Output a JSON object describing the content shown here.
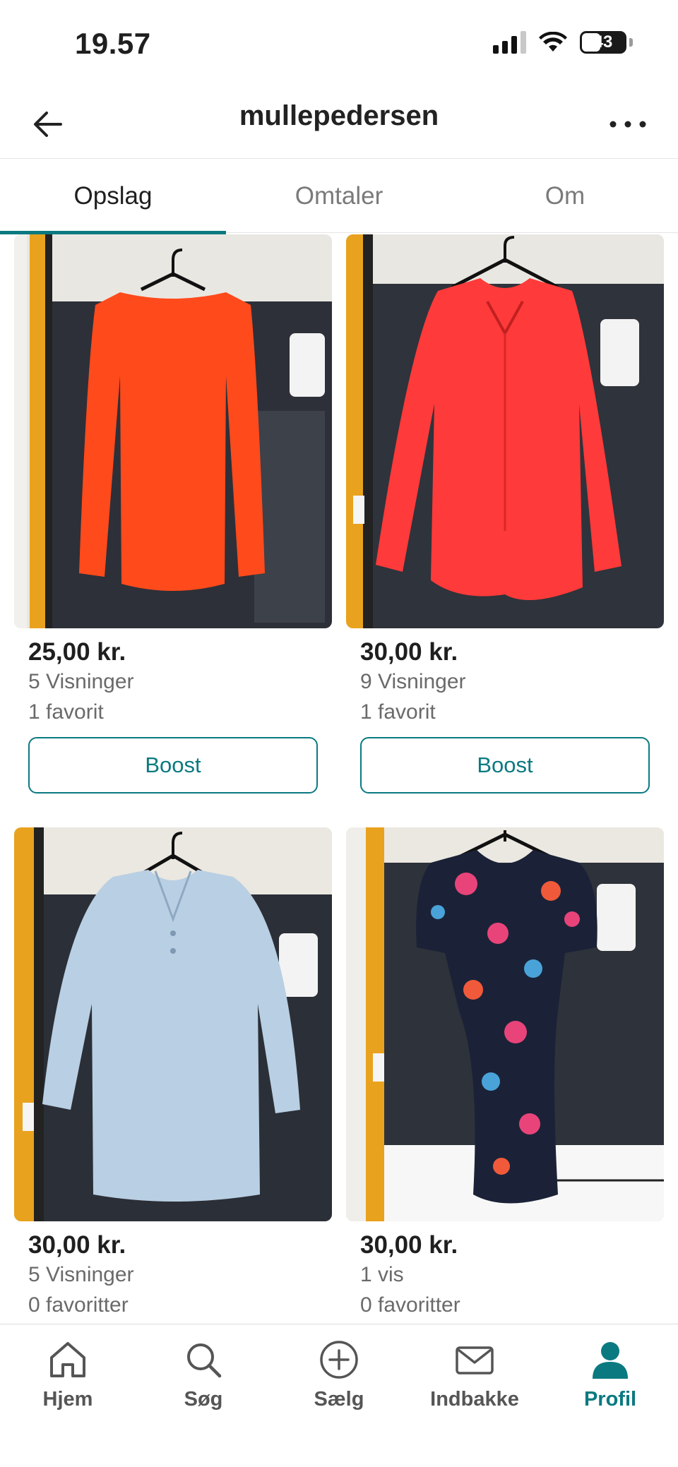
{
  "status_bar": {
    "time": "19.57",
    "battery": "43"
  },
  "header": {
    "title": "mullepedersen",
    "back_icon": "arrow-left-icon",
    "more_icon": "ellipsis-icon"
  },
  "tabs": [
    {
      "label": "Opslag",
      "active": true
    },
    {
      "label": "Omtaler",
      "active": false
    },
    {
      "label": "Om",
      "active": false
    }
  ],
  "listings": [
    {
      "price": "25,00 kr.",
      "views": "5 Visninger",
      "favorites": "1 favorit",
      "boost_label": "Boost",
      "garment_color": "#ff4a1c"
    },
    {
      "price": "30,00 kr.",
      "views": "9 Visninger",
      "favorites": "1 favorit",
      "boost_label": "Boost",
      "garment_color": "#ff3a3a"
    },
    {
      "price": "30,00 kr.",
      "views": "5 Visninger",
      "favorites": "0 favoritter",
      "garment_color": "#b9cfe3"
    },
    {
      "price": "30,00 kr.",
      "views": "1 vis",
      "favorites": "0 favoritter",
      "garment_color": "#1b2238"
    }
  ],
  "bottom_nav": [
    {
      "label": "Hjem",
      "icon": "home-icon",
      "active": false
    },
    {
      "label": "Søg",
      "icon": "search-icon",
      "active": false
    },
    {
      "label": "Sælg",
      "icon": "plus-circle-icon",
      "active": false
    },
    {
      "label": "Indbakke",
      "icon": "mail-icon",
      "active": false
    },
    {
      "label": "Profil",
      "icon": "profile-icon",
      "active": true
    }
  ],
  "colors": {
    "accent": "#0a7a80",
    "text": "#1f1f1f",
    "muted": "#6a6a6a"
  }
}
